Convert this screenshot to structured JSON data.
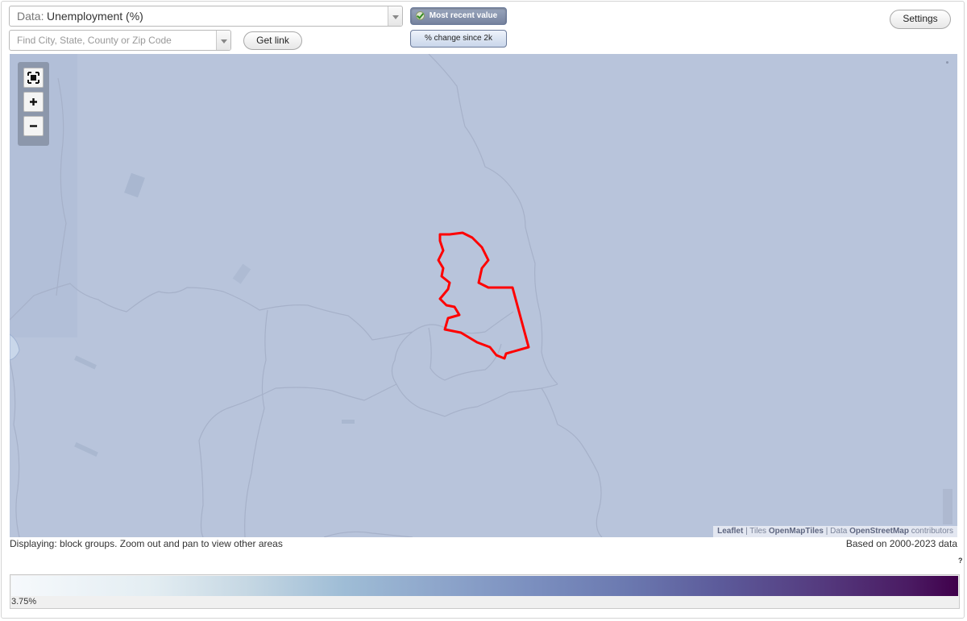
{
  "controls": {
    "data_prefix": "Data:",
    "data_value": "Unemployment (%)",
    "search_placeholder": "Find City, State, County or Zip Code",
    "get_link_label": "Get link",
    "settings_label": "Settings",
    "toggle_recent_label": "Most recent value",
    "toggle_change_label": "% change since 2k"
  },
  "map": {
    "background_color": "#b8c4db",
    "highlight_color": "#ff0000",
    "zoom_buttons": [
      "fullscreen-icon",
      "zoom-in-icon",
      "zoom-out-icon"
    ],
    "attribution": {
      "leaflet": "Leaflet",
      "sep1": " | Tiles ",
      "tiles": "OpenMapTiles",
      "sep2": " | Data ",
      "data": "OpenStreetMap",
      "tail": " contributors"
    }
  },
  "footer": {
    "display_note": "Displaying: block groups. Zoom out and pan to view other areas",
    "based_on": "Based on 2000-2023 data",
    "help": "?"
  },
  "legend": {
    "min_label": "3.75%",
    "colors": [
      "#f6f9fc",
      "#9fbdd6",
      "#7b8fbf",
      "#553c80",
      "#40004b"
    ]
  }
}
